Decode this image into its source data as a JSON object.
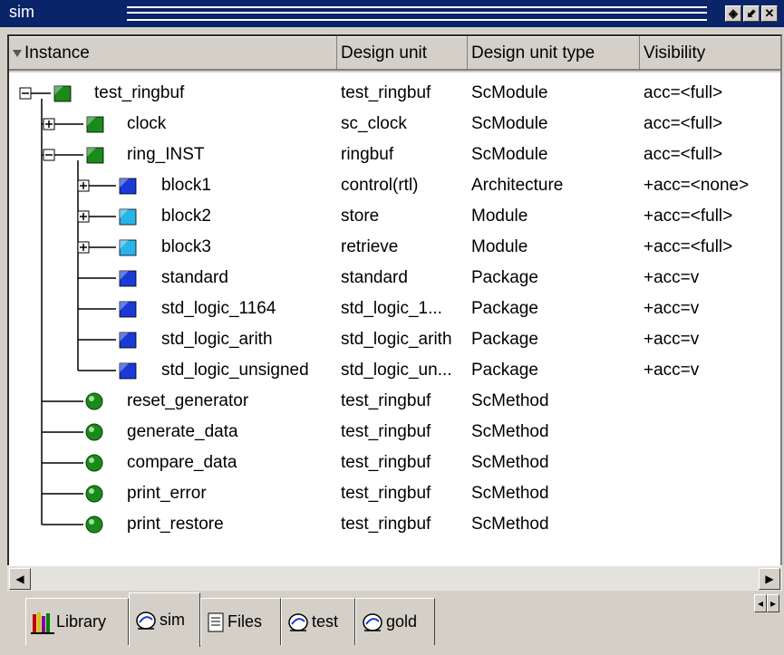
{
  "window": {
    "title": "sim"
  },
  "title_buttons": [
    {
      "name": "dock-button",
      "glyph": "◈"
    },
    {
      "name": "undock-button",
      "glyph": "⬋"
    },
    {
      "name": "close-button",
      "glyph": "✕"
    }
  ],
  "columns": [
    {
      "label": "Instance"
    },
    {
      "label": "Design unit"
    },
    {
      "label": "Design unit type"
    },
    {
      "label": "Visibility"
    }
  ],
  "rows": [
    {
      "instance": "test_ringbuf",
      "design_unit": "test_ringbuf",
      "type": "ScModule",
      "visibility": "acc=<full>",
      "icon": "green-cube-icon",
      "expander": "minus"
    },
    {
      "instance": "clock",
      "design_unit": "sc_clock",
      "type": "ScModule",
      "visibility": "acc=<full>",
      "icon": "green-cube-icon",
      "expander": "plus"
    },
    {
      "instance": "ring_INST",
      "design_unit": "ringbuf",
      "type": "ScModule",
      "visibility": "acc=<full>",
      "icon": "green-cube-icon",
      "expander": "minus"
    },
    {
      "instance": "block1",
      "design_unit": "control(rtl)",
      "type": "Architecture",
      "visibility": "+acc=<none>",
      "icon": "blue-cube-icon",
      "expander": "plus"
    },
    {
      "instance": "block2",
      "design_unit": "store",
      "type": "Module",
      "visibility": "+acc=<full>",
      "icon": "cyan-cube-icon",
      "expander": "plus"
    },
    {
      "instance": "block3",
      "design_unit": "retrieve",
      "type": "Module",
      "visibility": "+acc=<full>",
      "icon": "cyan-cube-icon",
      "expander": "plus"
    },
    {
      "instance": "standard",
      "design_unit": "standard",
      "type": "Package",
      "visibility": "+acc=v",
      "icon": "blue-cube-icon",
      "expander": "none"
    },
    {
      "instance": "std_logic_1164",
      "design_unit": "std_logic_1...",
      "type": "Package",
      "visibility": "+acc=v",
      "icon": "blue-cube-icon",
      "expander": "none"
    },
    {
      "instance": "std_logic_arith",
      "design_unit": "std_logic_arith",
      "type": "Package",
      "visibility": "+acc=v",
      "icon": "blue-cube-icon",
      "expander": "none"
    },
    {
      "instance": "std_logic_unsigned",
      "design_unit": "std_logic_un...",
      "type": "Package",
      "visibility": "+acc=v",
      "icon": "blue-cube-icon",
      "expander": "none"
    },
    {
      "instance": "reset_generator",
      "design_unit": "test_ringbuf",
      "type": "ScMethod",
      "visibility": "",
      "icon": "green-sphere-icon",
      "expander": "none"
    },
    {
      "instance": "generate_data",
      "design_unit": "test_ringbuf",
      "type": "ScMethod",
      "visibility": "",
      "icon": "green-sphere-icon",
      "expander": "none"
    },
    {
      "instance": "compare_data",
      "design_unit": "test_ringbuf",
      "type": "ScMethod",
      "visibility": "",
      "icon": "green-sphere-icon",
      "expander": "none"
    },
    {
      "instance": "print_error",
      "design_unit": "test_ringbuf",
      "type": "ScMethod",
      "visibility": "",
      "icon": "green-sphere-icon",
      "expander": "none"
    },
    {
      "instance": "print_restore",
      "design_unit": "test_ringbuf",
      "type": "ScMethod",
      "visibility": "",
      "icon": "green-sphere-icon",
      "expander": "none"
    }
  ],
  "tabs": [
    {
      "label": "Library",
      "icon": "library-icon",
      "active": false
    },
    {
      "label": "sim",
      "icon": "sim-icon",
      "active": true
    },
    {
      "label": "Files",
      "icon": "files-icon",
      "active": false
    },
    {
      "label": "test",
      "icon": "sim-icon",
      "active": false
    },
    {
      "label": "gold",
      "icon": "sim-icon",
      "active": false
    }
  ],
  "colors": {
    "title_bar": "#0a246a",
    "panel_bg": "#d4d0c8",
    "green_cube": "#1a8a1a",
    "blue_cube": "#1a3ad8",
    "cyan_cube": "#28b4e8"
  }
}
